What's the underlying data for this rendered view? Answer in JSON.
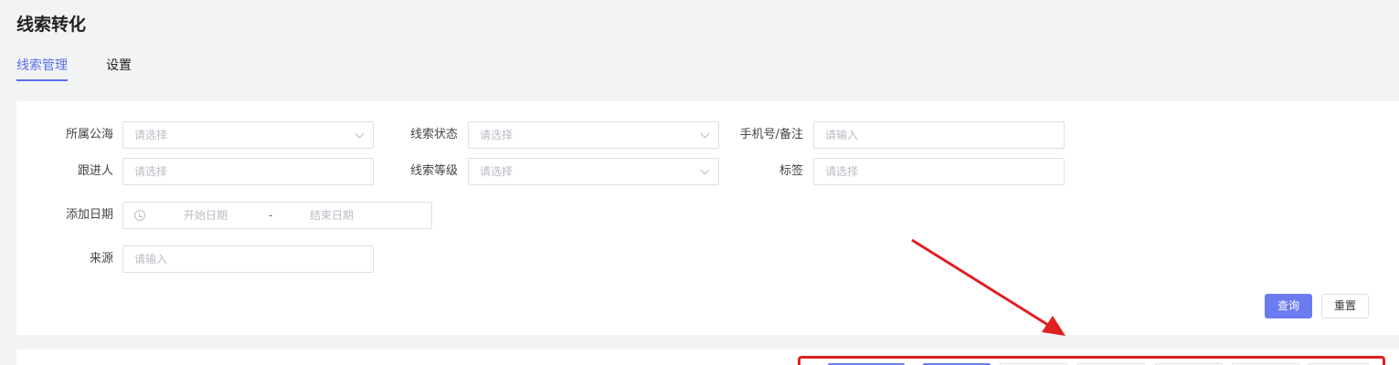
{
  "header": {
    "title": "线索转化",
    "tabs": [
      {
        "label": "线索管理",
        "active": true
      },
      {
        "label": "设置",
        "active": false
      }
    ]
  },
  "filters": {
    "public_sea": {
      "label": "所属公海",
      "placeholder": "请选择"
    },
    "status": {
      "label": "线索状态",
      "placeholder": "请选择"
    },
    "phone_note": {
      "label": "手机号/备注",
      "placeholder": "请输入"
    },
    "follower": {
      "label": "跟进人",
      "placeholder": "请选择"
    },
    "level": {
      "label": "线索等级",
      "placeholder": "请选择"
    },
    "tag": {
      "label": "标签",
      "placeholder": "请选择"
    },
    "add_date": {
      "label": "添加日期",
      "start_placeholder": "开始日期",
      "separator": "-",
      "end_placeholder": "结束日期"
    },
    "source": {
      "label": "来源",
      "placeholder": "请输入"
    }
  },
  "actions": {
    "query_label": "查询",
    "reset_label": "重置"
  },
  "colors": {
    "accent": "#5b6ee8",
    "primary_button": "#6b7cf0",
    "annotation_red": "#e02020"
  }
}
